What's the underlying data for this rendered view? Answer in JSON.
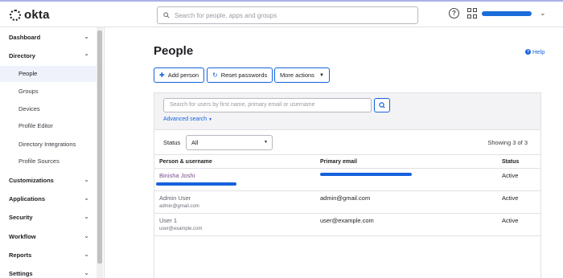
{
  "app": {
    "logo_text": "okta",
    "brand_color": "#1662dd"
  },
  "topbar": {
    "search_placeholder": "Search for people, apps and groups",
    "help_icon": "question-circle-icon",
    "apps_icon": "grid-icon"
  },
  "sidebar": {
    "groups": [
      {
        "label": "Dashboard",
        "expanded": false
      },
      {
        "label": "Directory",
        "expanded": true
      },
      {
        "label": "Customizations",
        "expanded": false
      },
      {
        "label": "Applications",
        "expanded": false
      },
      {
        "label": "Security",
        "expanded": false
      },
      {
        "label": "Workflow",
        "expanded": false
      },
      {
        "label": "Reports",
        "expanded": false
      },
      {
        "label": "Settings",
        "expanded": false
      }
    ],
    "directory_items": [
      {
        "label": "People",
        "active": true
      },
      {
        "label": "Groups"
      },
      {
        "label": "Devices"
      },
      {
        "label": "Profile Editor"
      },
      {
        "label": "Directory Integrations"
      },
      {
        "label": "Profile Sources"
      }
    ]
  },
  "main": {
    "title": "People",
    "help_label": "Help",
    "actions": {
      "add_person": "Add person",
      "reset_passwords": "Reset passwords",
      "more_actions": "More actions"
    },
    "search_placeholder": "Search for users by first name, primary email or username",
    "advanced_search": "Advanced search",
    "status_label": "Status",
    "status_value": "All",
    "showing": "Showing 3 of 3",
    "columns": [
      "Person & username",
      "Primary email",
      "Status"
    ],
    "rows": [
      {
        "name": "Binisha Joshi",
        "username": "",
        "email": "",
        "status": "Active"
      },
      {
        "name": "Admin User",
        "username": "admin@gmail.com",
        "email": "admin@gmail.com",
        "status": "Active"
      },
      {
        "name": "User 1",
        "username": "user@example.com",
        "email": "user@example.com",
        "status": "Active"
      }
    ]
  }
}
